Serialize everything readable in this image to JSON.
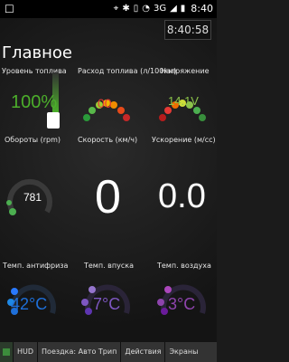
{
  "statusbar": {
    "time": "8:40",
    "icons": [
      "notification-icon",
      "location-icon",
      "bluetooth-icon",
      "vibrate-icon",
      "wifi-icon",
      "signal-icon",
      "battery-icon"
    ],
    "signal_label": "3G"
  },
  "screen": {
    "clock": "8:40:58",
    "title": "Главное"
  },
  "gauges": [
    {
      "label": "Уровень топлива",
      "value": "100%",
      "color": "#4caf2b",
      "fill": 1.0
    },
    {
      "label": "Расход топлива (л/100км)",
      "value": "00",
      "color": "#e53935",
      "fill": 0.0
    },
    {
      "label": "Напряжение",
      "value": "14.1V",
      "color": "#8bc34a",
      "fill": 0.55
    },
    {
      "label": "Обороты (rpm)",
      "value": "781",
      "color": "#ffffff",
      "fill": 0.1
    },
    {
      "label": "Скорость (км/ч)",
      "value": "0",
      "color": "#ffffff",
      "fill": 0.0
    },
    {
      "label": "Ускорение (м/сс)",
      "value": "0.0",
      "color": "#ffffff",
      "fill": 0.0
    },
    {
      "label": "Темп. антифриза",
      "value": "42°C",
      "color": "#1e6fd9",
      "fill": 0.1
    },
    {
      "label": "Темп. впуска",
      "value": "7°C",
      "color": "#7e57c2",
      "fill": 0.05
    },
    {
      "label": "Темп. воздуха",
      "value": "3°C",
      "color": "#8e44ad",
      "fill": 0.05
    }
  ],
  "nav": {
    "buttons": [
      "HUD",
      "Поездка: Авто Трип",
      "Действия",
      "Экраны"
    ]
  }
}
